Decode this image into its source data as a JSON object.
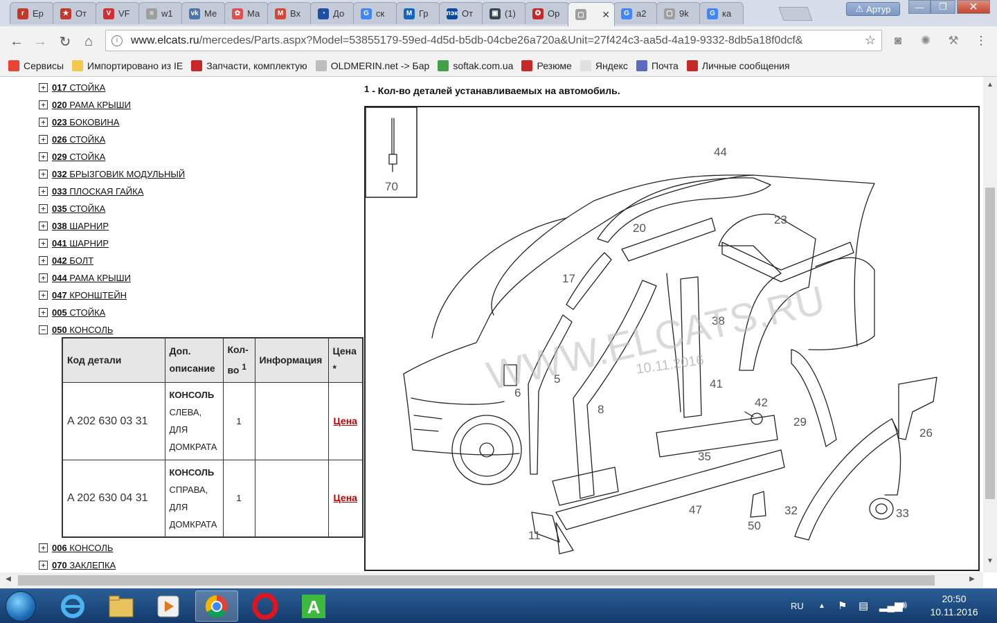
{
  "browser": {
    "tabs": [
      {
        "label": "Ер",
        "color": "#c0392b",
        "glyph": "r"
      },
      {
        "label": "От",
        "color": "#c0392b",
        "glyph": "★"
      },
      {
        "label": "VF",
        "color": "#d32f2f",
        "glyph": "V"
      },
      {
        "label": "w1",
        "color": "#9e9e9e",
        "glyph": "≡"
      },
      {
        "label": "Ме",
        "color": "#4a76a8",
        "glyph": "vk"
      },
      {
        "label": "Ма",
        "color": "#e05050",
        "glyph": "✿"
      },
      {
        "label": "Вх",
        "color": "#d44638",
        "glyph": "M"
      },
      {
        "label": "До",
        "color": "#1f4fa3",
        "glyph": "◔"
      },
      {
        "label": "ск",
        "color": "#4285f4",
        "glyph": "G"
      },
      {
        "label": "Гр",
        "color": "#1565c0",
        "glyph": "M"
      },
      {
        "label": "От",
        "color": "#0d47a1",
        "glyph": "пэк"
      },
      {
        "label": "(1)",
        "color": "#37474f",
        "glyph": "▣"
      },
      {
        "label": "Ор",
        "color": "#c62828",
        "glyph": "✪"
      },
      {
        "label": "",
        "color": "#9e9e9e",
        "glyph": "▢",
        "active": true
      },
      {
        "label": "a2",
        "color": "#4285f4",
        "glyph": "G"
      },
      {
        "label": "9k",
        "color": "#9e9e9e",
        "glyph": "▢"
      },
      {
        "label": "ка",
        "color": "#4285f4",
        "glyph": "G"
      }
    ],
    "user_label": "Артур",
    "url_host": "www.elcats.ru",
    "url_path": "/mercedes/Parts.aspx?Model=53855179-59ed-4d5d-b5db-04cbe26a720a&Unit=27f424c3-aa5d-4a19-9332-8db5a18f0dcf&",
    "bookmarks": [
      {
        "label": "Сервисы",
        "color": "#ea4335"
      },
      {
        "label": "Импортировано из IE",
        "color": "#f2c94c"
      },
      {
        "label": "Запчасти, комплектую",
        "color": "#c62828"
      },
      {
        "label": "OLDMERIN.net -> Бар",
        "color": "#bdbdbd"
      },
      {
        "label": "softak.com.ua",
        "color": "#43a047"
      },
      {
        "label": "Резюме",
        "color": "#c62828"
      },
      {
        "label": "Яндекс",
        "color": "#e0e0e0"
      },
      {
        "label": "Почта",
        "color": "#5c6bc0"
      },
      {
        "label": "Личные сообщения",
        "color": "#c62828"
      }
    ]
  },
  "tree": {
    "items": [
      {
        "code": "017",
        "name": "СТОЙКА",
        "sign": "+"
      },
      {
        "code": "020",
        "name": "РАМА КРЫШИ",
        "sign": "+"
      },
      {
        "code": "023",
        "name": "БОКОВИНА",
        "sign": "+"
      },
      {
        "code": "026",
        "name": "СТОЙКА",
        "sign": "+"
      },
      {
        "code": "029",
        "name": "СТОЙКА",
        "sign": "+"
      },
      {
        "code": "032",
        "name": "БРЫЗГОВИК МОДУЛЬНЫЙ",
        "sign": "+"
      },
      {
        "code": "033",
        "name": "ПЛОСКАЯ ГАЙКА",
        "sign": "+"
      },
      {
        "code": "035",
        "name": "СТОЙКА",
        "sign": "+"
      },
      {
        "code": "038",
        "name": "ШАРНИР",
        "sign": "+"
      },
      {
        "code": "041",
        "name": "ШАРНИР",
        "sign": "+"
      },
      {
        "code": "042",
        "name": "БОЛТ",
        "sign": "+"
      },
      {
        "code": "044",
        "name": "РАМА КРЫШИ",
        "sign": "+"
      },
      {
        "code": "047",
        "name": "КРОНШТЕЙН",
        "sign": "+"
      },
      {
        "code": "005",
        "name": "СТОЙКА",
        "sign": "+"
      },
      {
        "code": "050",
        "name": "КОНСОЛЬ",
        "sign": "−"
      }
    ],
    "after": [
      {
        "code": "006",
        "name": "КОНСОЛЬ",
        "sign": "+"
      },
      {
        "code": "070",
        "name": "ЗАКЛЕПКА",
        "sign": "+"
      }
    ]
  },
  "table": {
    "headers": {
      "code": "Код детали",
      "desc_1": "Доп.",
      "desc_2": "описание",
      "qty_1": "Кол-",
      "qty_2": "во",
      "qty_sup": "1",
      "info": "Информация",
      "price_1": "Цена",
      "price_2": "*"
    },
    "rows": [
      {
        "part_no": "A 202 630 03 31",
        "desc_title": "КОНСОЛЬ",
        "desc_lines": [
          "СЛЕВА,",
          "ДЛЯ",
          "ДОМКРАТА"
        ],
        "qty": "1",
        "info": "",
        "price": "Цена"
      },
      {
        "part_no": "A 202 630 04 31",
        "desc_title": "КОНСОЛЬ",
        "desc_lines": [
          "СПРАВА,",
          "ДЛЯ",
          "ДОМКРАТА"
        ],
        "qty": "1",
        "info": "",
        "price": "Цена"
      }
    ]
  },
  "note": {
    "num": "1",
    "text": "- Кол-во деталей устанавливаемых на автомобиль."
  },
  "diagram": {
    "watermark": "WWW.ELCATS.RU",
    "date_stamp": "10.11.2016",
    "callouts": [
      "70",
      "44",
      "20",
      "23",
      "17",
      "38",
      "41",
      "42",
      "5",
      "6",
      "8",
      "35",
      "29",
      "26",
      "47",
      "50",
      "32",
      "33",
      "11"
    ]
  },
  "taskbar": {
    "lang": "RU",
    "time": "20:50",
    "date": "10.11.2016"
  }
}
